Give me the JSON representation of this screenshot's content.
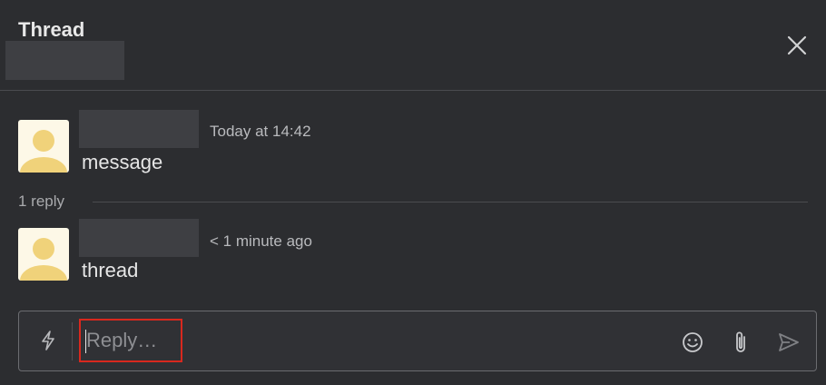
{
  "header": {
    "title": "Thread"
  },
  "messages": [
    {
      "timestamp": "Today at 14:42",
      "text": "message"
    },
    {
      "timestamp": "< 1 minute ago",
      "text": "thread"
    }
  ],
  "replies": {
    "count_label": "1 reply"
  },
  "composer": {
    "placeholder": "Reply…"
  },
  "icons": {
    "close": "close-icon",
    "shortcuts": "lightning-bolt-icon",
    "emoji": "smiley-icon",
    "attach": "paperclip-icon",
    "send": "paper-plane-icon"
  },
  "colors": {
    "background": "#2c2d30",
    "highlight_box": "#d8281e",
    "avatar_bg": "#fdf8e7",
    "avatar_fg": "#f0d27a"
  }
}
